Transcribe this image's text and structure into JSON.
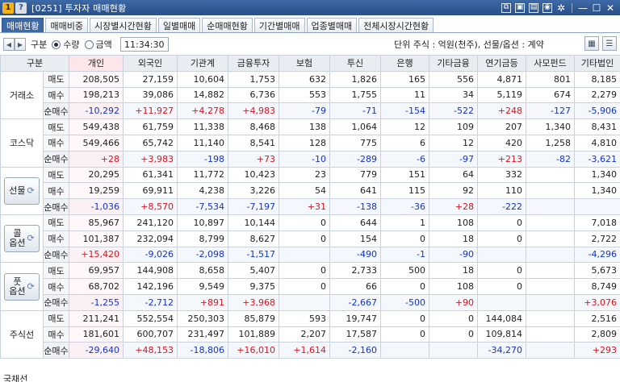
{
  "window": {
    "screen_no": "0251",
    "title": "[0251] 투자자 매매현황",
    "badge_num": "1",
    "badge_help": "?"
  },
  "tabs": [
    {
      "label": "매매현황",
      "active": true
    },
    {
      "label": "매매비중"
    },
    {
      "label": "시장별시간현황"
    },
    {
      "label": "일별매매"
    },
    {
      "label": "순매매현황"
    },
    {
      "label": "기간별매매"
    },
    {
      "label": "업종별매매"
    },
    {
      "label": "전체시장시간현황"
    }
  ],
  "controls": {
    "category_label": "구분",
    "radio_quantity": "수량",
    "radio_amount": "금액",
    "selected": "수량",
    "time": "11:34:30",
    "unit_text": "단위 주식 : 억원(천주), 선물/옵션 : 계약"
  },
  "columns": [
    "구분",
    "개인",
    "외국인",
    "기관계",
    "금융투자",
    "보험",
    "투신",
    "은행",
    "기타금융",
    "연기금등",
    "사모펀드",
    "기타법인"
  ],
  "row_labels": {
    "sell": "매도",
    "buy": "매수",
    "net": "순매수"
  },
  "groups": [
    {
      "name": "거래소",
      "button": false,
      "sell": [
        "208,505",
        "27,159",
        "10,604",
        "1,753",
        "632",
        "1,826",
        "165",
        "556",
        "4,871",
        "801",
        "8,185"
      ],
      "buy": [
        "198,213",
        "39,086",
        "14,882",
        "6,736",
        "553",
        "1,755",
        "11",
        "34",
        "5,119",
        "674",
        "2,279"
      ],
      "net": [
        "-10,292",
        "+11,927",
        "+4,278",
        "+4,983",
        "-79",
        "-71",
        "-154",
        "-522",
        "+248",
        "-127",
        "-5,906"
      ]
    },
    {
      "name": "코스닥",
      "button": false,
      "sell": [
        "549,438",
        "61,759",
        "11,338",
        "8,468",
        "138",
        "1,064",
        "12",
        "109",
        "207",
        "1,340",
        "8,431"
      ],
      "buy": [
        "549,466",
        "65,742",
        "11,140",
        "8,541",
        "128",
        "775",
        "6",
        "12",
        "420",
        "1,258",
        "4,810"
      ],
      "net": [
        "+28",
        "+3,983",
        "-198",
        "+73",
        "-10",
        "-289",
        "-6",
        "-97",
        "+213",
        "-82",
        "-3,621"
      ]
    },
    {
      "name": "선물",
      "button": true,
      "sell": [
        "20,295",
        "61,341",
        "11,772",
        "10,423",
        "23",
        "779",
        "151",
        "64",
        "332",
        "",
        "1,340"
      ],
      "buy": [
        "19,259",
        "69,911",
        "4,238",
        "3,226",
        "54",
        "641",
        "115",
        "92",
        "110",
        "",
        "1,340"
      ],
      "net": [
        "-1,036",
        "+8,570",
        "-7,534",
        "-7,197",
        "+31",
        "-138",
        "-36",
        "+28",
        "-222",
        "",
        ""
      ]
    },
    {
      "name": "콜옵션",
      "line1": "콜",
      "line2": "옵션",
      "button": true,
      "sell": [
        "85,967",
        "241,120",
        "10,897",
        "10,144",
        "0",
        "644",
        "1",
        "108",
        "0",
        "",
        "7,018"
      ],
      "buy": [
        "101,387",
        "232,094",
        "8,799",
        "8,627",
        "0",
        "154",
        "0",
        "18",
        "0",
        "",
        "2,722"
      ],
      "net": [
        "+15,420",
        "-9,026",
        "-2,098",
        "-1,517",
        "",
        "-490",
        "-1",
        "-90",
        "",
        "",
        "-4,296"
      ]
    },
    {
      "name": "풋옵션",
      "line1": "풋",
      "line2": "옵션",
      "button": true,
      "sell": [
        "69,957",
        "144,908",
        "8,658",
        "5,407",
        "0",
        "2,733",
        "500",
        "18",
        "0",
        "",
        "5,673"
      ],
      "buy": [
        "68,702",
        "142,196",
        "9,549",
        "9,375",
        "0",
        "66",
        "0",
        "108",
        "0",
        "",
        "8,749"
      ],
      "net": [
        "-1,255",
        "-2,712",
        "+891",
        "+3,968",
        "",
        "-2,667",
        "-500",
        "+90",
        "",
        "",
        "+3,076"
      ]
    },
    {
      "name": "주식선",
      "button": false,
      "sell": [
        "211,241",
        "552,554",
        "250,303",
        "85,879",
        "593",
        "19,747",
        "0",
        "0",
        "144,084",
        "",
        "2,516"
      ],
      "buy": [
        "181,601",
        "600,707",
        "231,497",
        "101,889",
        "2,207",
        "17,587",
        "0",
        "0",
        "109,814",
        "",
        "2,809"
      ],
      "net": [
        "-29,640",
        "+48,153",
        "-18,806",
        "+16,010",
        "+1,614",
        "-2,160",
        "",
        "",
        "-34,270",
        "",
        "+293"
      ]
    }
  ],
  "footer_cut": "국채선"
}
